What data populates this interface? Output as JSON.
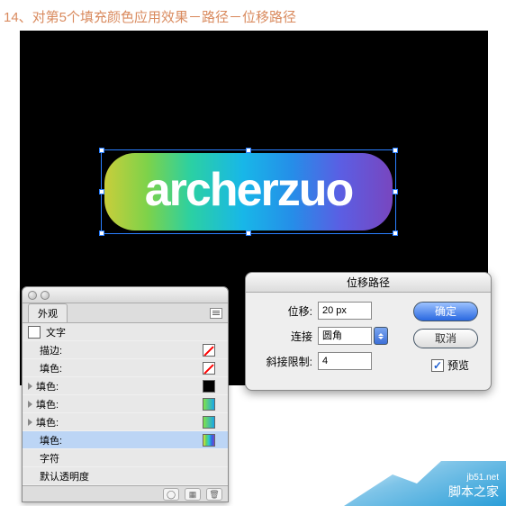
{
  "caption": "14、对第5个填充颜色应用效果－路径－位移路径",
  "artwork_text": "archerzuo",
  "appearance": {
    "tab": "外观",
    "header": "文字",
    "rows": [
      {
        "label": "描边:",
        "swatch": "none",
        "tri": false
      },
      {
        "label": "填色:",
        "swatch": "none",
        "tri": false
      },
      {
        "label": "填色:",
        "swatch": "black",
        "tri": true
      },
      {
        "label": "填色:",
        "swatch": "gb",
        "tri": true
      },
      {
        "label": "填色:",
        "swatch": "gb",
        "tri": true
      },
      {
        "label": "填色:",
        "swatch": "rainbow",
        "tri": false,
        "selected": true
      },
      {
        "label": "字符",
        "swatch": "",
        "tri": false
      },
      {
        "label": "默认透明度",
        "swatch": "",
        "tri": false
      }
    ]
  },
  "dialog": {
    "title": "位移路径",
    "offset_label": "位移:",
    "offset_value": "20 px",
    "join_label": "连接",
    "join_value": "圆角",
    "miter_label": "斜接限制:",
    "miter_value": "4",
    "ok": "确定",
    "cancel": "取消",
    "preview": "预览"
  },
  "watermark": {
    "url": "jb51.net",
    "name": "脚本之家"
  }
}
